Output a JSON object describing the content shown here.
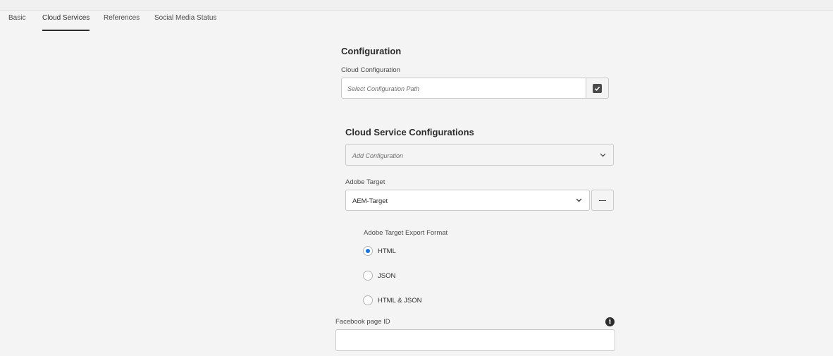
{
  "tabs": [
    {
      "label": "Basic",
      "active": false
    },
    {
      "label": "Cloud Services",
      "active": true
    },
    {
      "label": "References",
      "active": false
    },
    {
      "label": "Social Media Status",
      "active": false
    }
  ],
  "configuration": {
    "heading": "Configuration",
    "field_label": "Cloud Configuration",
    "placeholder": "Select Configuration Path",
    "picker_icon": "checkbox-picker-icon"
  },
  "cloud_services": {
    "heading": "Cloud Service Configurations",
    "add_placeholder": "Add Configuration",
    "adobe_target": {
      "label": "Adobe Target",
      "selected": "AEM-Target",
      "remove_icon": "minus-icon"
    },
    "export_format": {
      "label": "Adobe Target Export Format",
      "options": [
        {
          "label": "HTML",
          "checked": true
        },
        {
          "label": "JSON",
          "checked": false
        },
        {
          "label": "HTML & JSON",
          "checked": false
        }
      ]
    }
  },
  "facebook": {
    "label": "Facebook page ID",
    "value": "",
    "info_icon": "info-icon"
  },
  "colors": {
    "accent": "#1473e6",
    "background": "#f4f4f4",
    "text": "#2c2c2c"
  }
}
